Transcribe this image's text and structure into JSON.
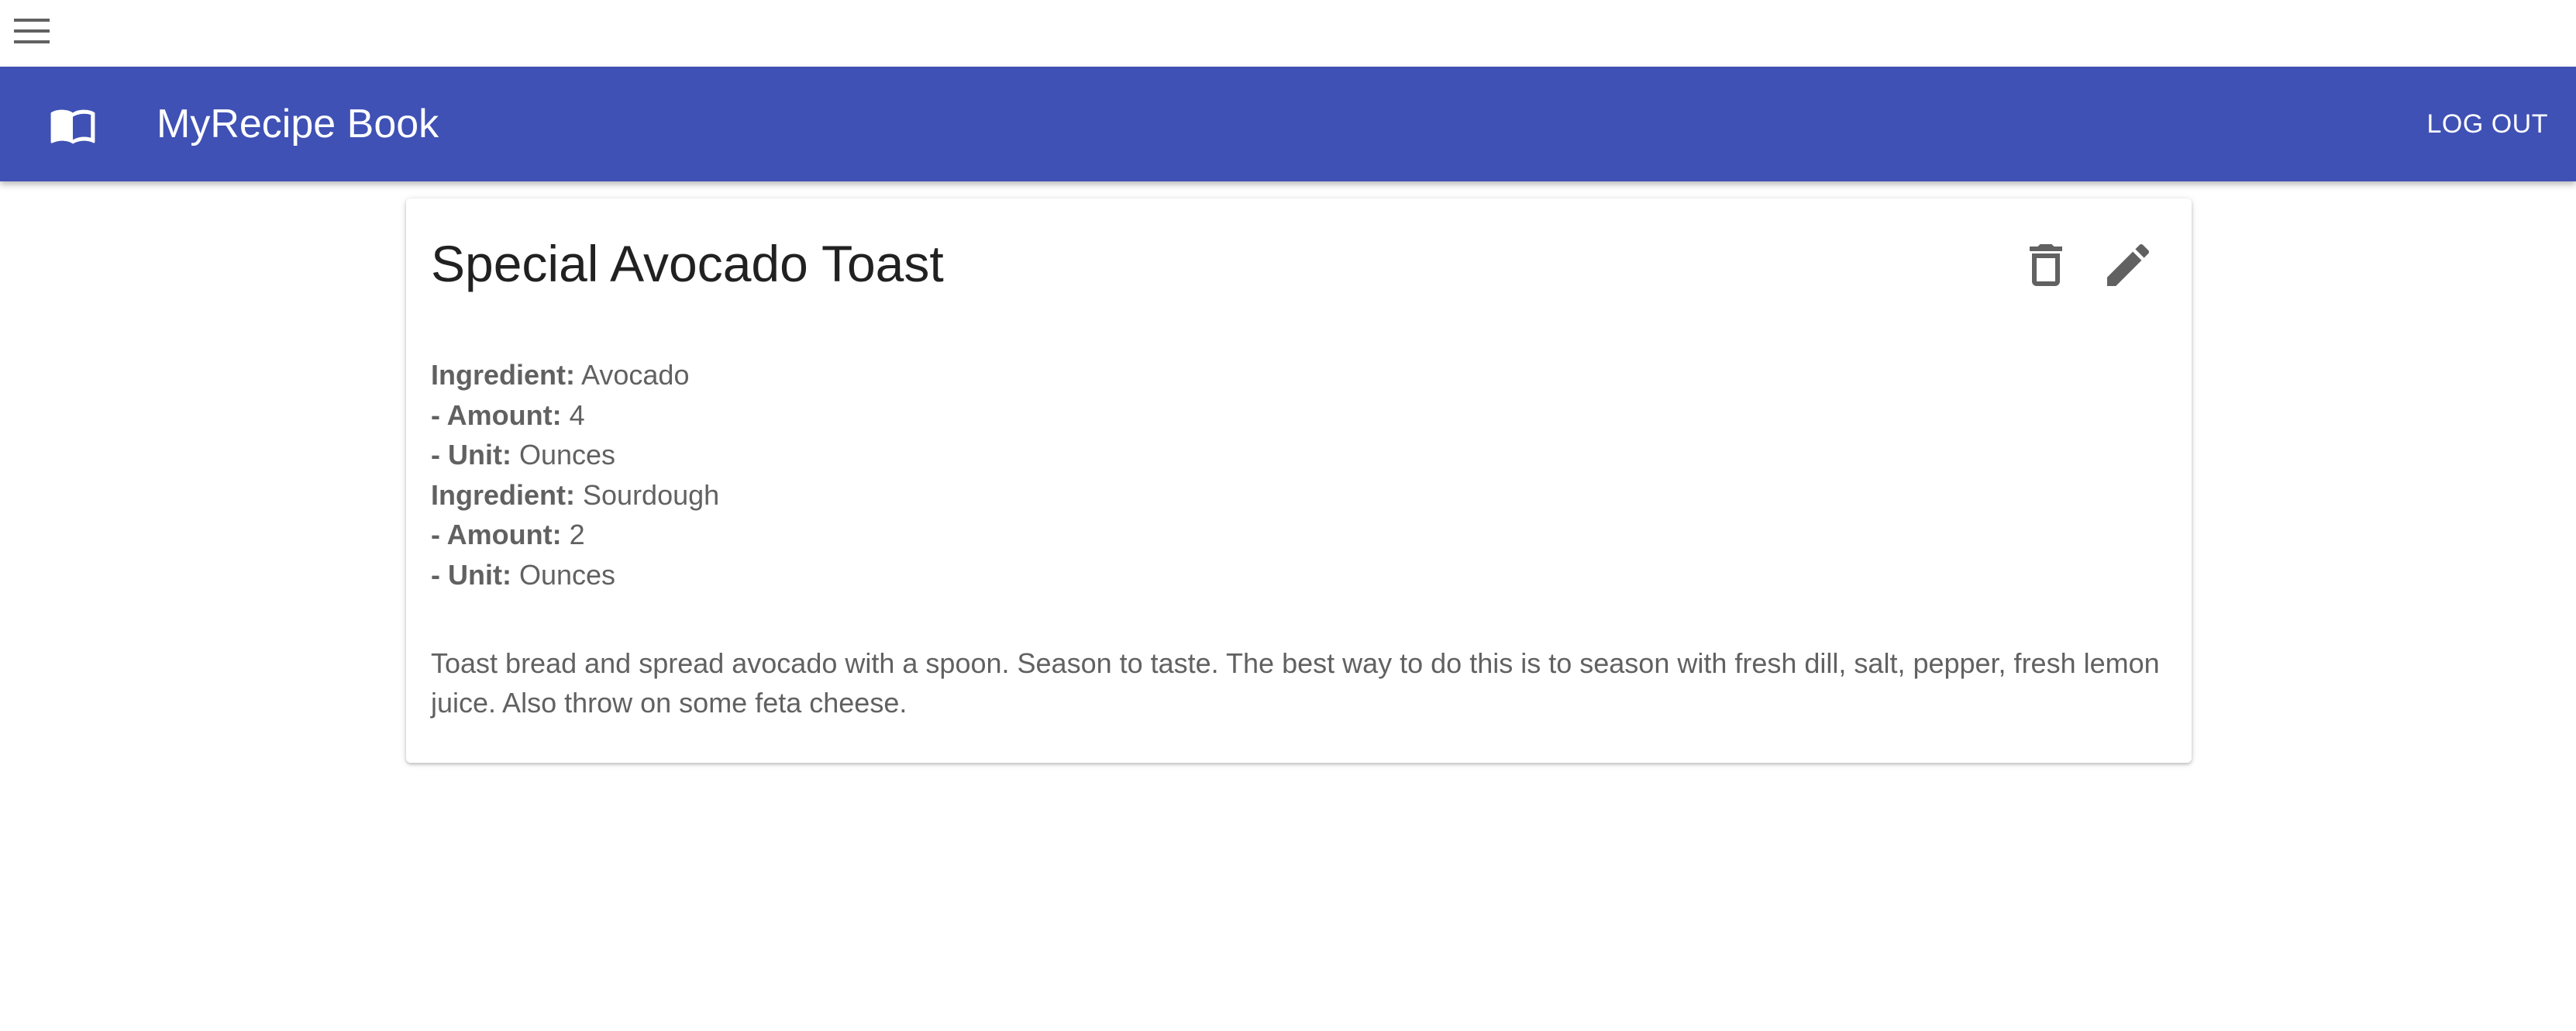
{
  "header": {
    "title": "MyRecipe Book",
    "logout_label": "LOG OUT",
    "brand_color": "#3f51b5",
    "menu_icon": "hamburger-menu-icon",
    "brand_icon": "open-book-icon"
  },
  "recipe": {
    "title": "Special Avocado Toast",
    "delete_icon": "trash-icon",
    "edit_icon": "pencil-icon",
    "labels": {
      "ingredient": "Ingredient:",
      "amount": "- Amount:",
      "unit": "- Unit:"
    },
    "ingredients": [
      {
        "name": "Avocado",
        "amount": "4",
        "unit": "Ounces"
      },
      {
        "name": "Sourdough",
        "amount": "2",
        "unit": "Ounces"
      }
    ],
    "instructions": "Toast bread and spread avocado with a spoon. Season to taste. The best way to do this is to season with fresh dill, salt, pepper, fresh lemon juice. Also throw on some feta cheese."
  }
}
